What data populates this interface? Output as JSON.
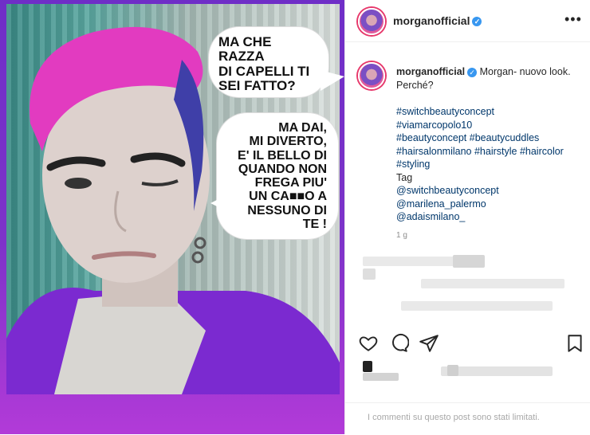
{
  "post_image": {
    "bubble_top": [
      "MA CHE RAZZA",
      "DI CAPELLI TI",
      "SEI FATTO?"
    ],
    "bubble_bottom": [
      "MA DAI,",
      "MI DIVERTO,",
      "E' IL BELLO DI",
      "QUANDO NON",
      "FREGA PIU'",
      "UN CA■■O A",
      "NESSUNO DI TE !"
    ]
  },
  "header": {
    "username": "morganofficial",
    "more": "•••"
  },
  "caption": {
    "username": "morganofficial",
    "text": " Morgan- nuovo look. Perché?",
    "hashtags": [
      "#switchbeautyconcept",
      "#viamarcopolo10",
      "#beautyconcept #beautycuddles",
      "#hairsalonmilano #hairstyle #haircolor",
      "#styling"
    ],
    "tag_label": "Tag",
    "mentions": [
      "@switchbeautyconcept",
      "@marilena_palermo",
      "@adaismilano_"
    ],
    "time": "1 g"
  },
  "footer": {
    "limited_text": "I commenti su questo post sono stati limitati."
  },
  "colors": {
    "accent_blue": "#00376b",
    "verified": "#3897f0",
    "frame_purple": "#7d33c9"
  }
}
